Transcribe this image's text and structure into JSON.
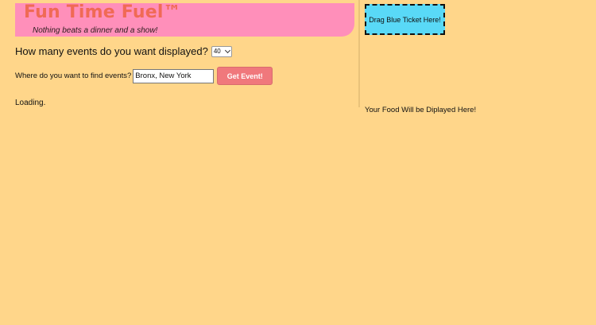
{
  "header": {
    "brand": "Fun Time Fuel™",
    "tagline": "Nothing beats a dinner and a show!"
  },
  "events_count": {
    "label": "How many events do you want displayed?",
    "selected": "40"
  },
  "location": {
    "label": "Where do you want to find events?",
    "value": "Bronx, New York"
  },
  "submit": {
    "label": "Get Event!"
  },
  "status": {
    "loading": "Loading."
  },
  "ticket_drop": {
    "label": "Drag Blue Ticket Here!"
  },
  "food_panel": {
    "label": "Your Food Will be Diplayed Here!"
  },
  "colors": {
    "background": "#ffd68a",
    "banner": "#ff8fba",
    "brand_text": "#f06a55",
    "button": "#f0787c",
    "ticket": "#59d9f7"
  }
}
